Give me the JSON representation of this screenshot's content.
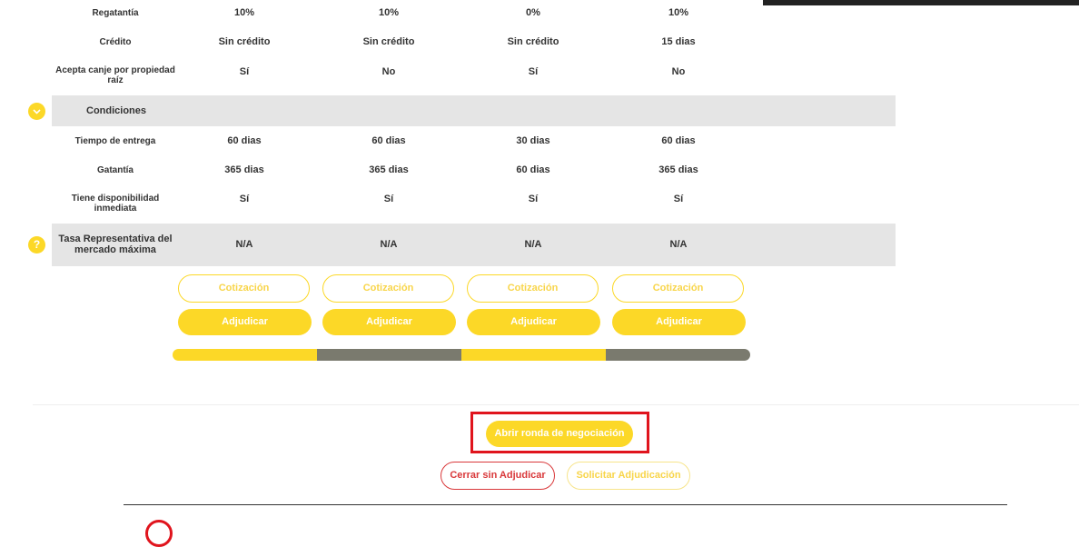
{
  "columns_count": 4,
  "rows_top": [
    {
      "label": "Regatantía",
      "values": [
        "10%",
        "10%",
        "0%",
        "10%"
      ]
    },
    {
      "label": "Crédito",
      "values": [
        "Sin crédito",
        "Sin crédito",
        "Sin crédito",
        "15 dias"
      ]
    },
    {
      "label": "Acepta canje por propiedad raíz",
      "values": [
        "Sí",
        "No",
        "Sí",
        "No"
      ]
    }
  ],
  "conditions": {
    "title": "Condiciones",
    "icon": "chevron-down-icon",
    "rows": [
      {
        "label": "Tiempo de entrega",
        "values": [
          "60 dias",
          "60 dias",
          "30 dias",
          "60 dias"
        ]
      },
      {
        "label": "Gatantía",
        "values": [
          "365 dias",
          "365 dias",
          "60 dias",
          "365 dias"
        ]
      },
      {
        "label": "Tiene disponibilidad inmediata",
        "values": [
          "Sí",
          "Sí",
          "Sí",
          "Sí"
        ]
      }
    ]
  },
  "trm": {
    "icon": "question-icon",
    "icon_glyph": "?",
    "label": "Tasa Representativa del mercado máxima",
    "values": [
      "N/A",
      "N/A",
      "N/A",
      "N/A"
    ]
  },
  "supplier_actions": {
    "quote_label": "Cotización",
    "award_label": "Adjudicar"
  },
  "progress": {
    "segment_colors": [
      "#fcd827",
      "#7a7a6e",
      "#fcd827",
      "#7a7a6e"
    ]
  },
  "footer_actions": {
    "open_round_label": "Abrir ronda de negociación",
    "close_label": "Cerrar sin Adjudicar",
    "request_label": "Solicitar Adjudicación"
  },
  "colors": {
    "accent": "#fcd827",
    "danger": "#e0141d",
    "row_gray": "#e5e5e5"
  }
}
